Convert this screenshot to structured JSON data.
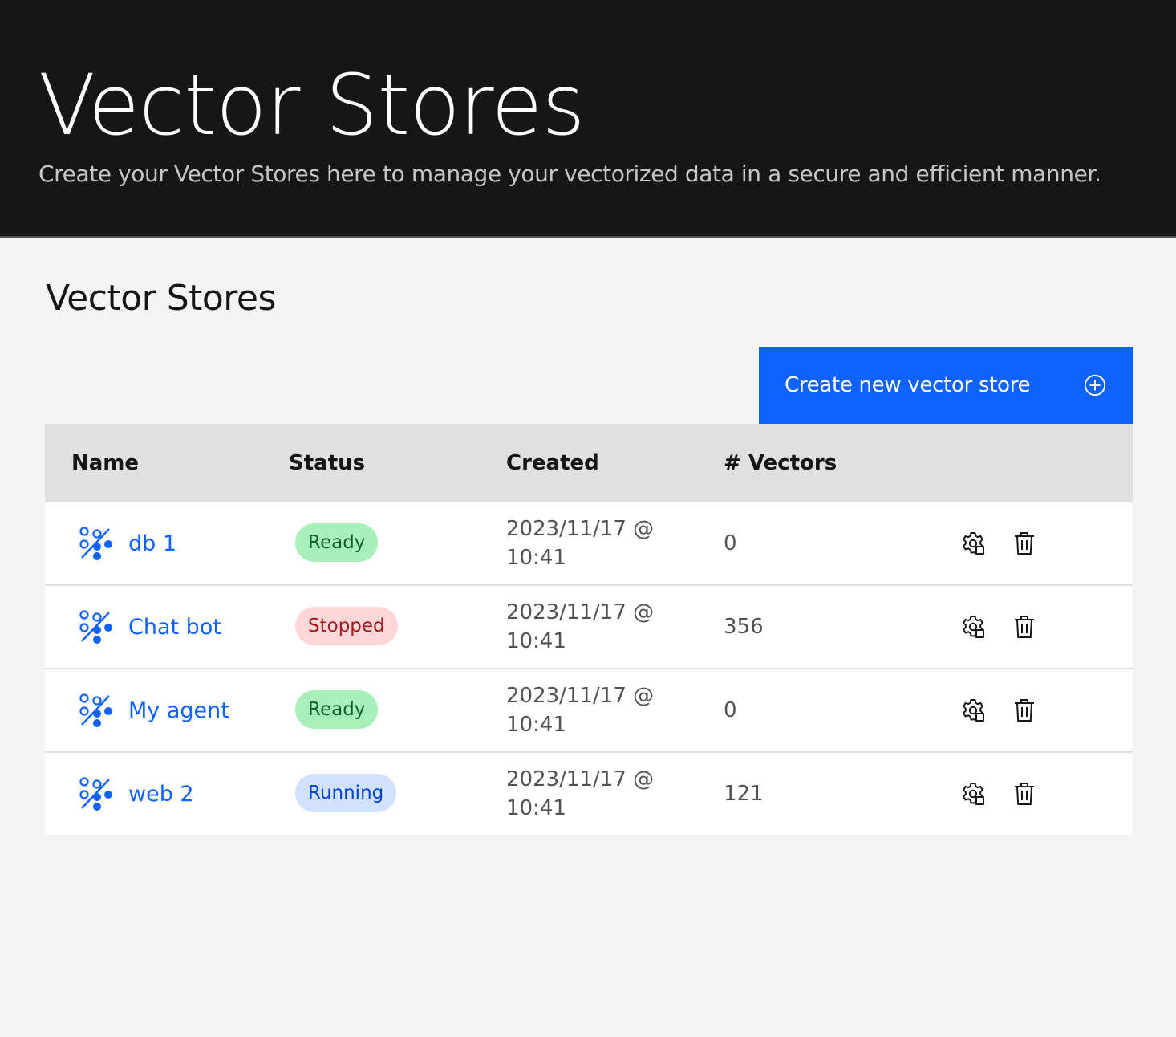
{
  "hero": {
    "title": "Vector Stores",
    "subtitle": "Create your Vector Stores here to manage your vectorized data in a secure and efficient manner."
  },
  "section": {
    "title": "Vector Stores"
  },
  "toolbar": {
    "create_label": "Create new vector store",
    "create_icon": "add-circle-icon"
  },
  "table": {
    "headers": [
      "Name",
      "Status",
      "Created",
      "# Vectors",
      ""
    ],
    "rows": [
      {
        "name": "db 1",
        "status": "Ready",
        "status_kind": "ready",
        "created": "2023/11/17 @ 10:41",
        "vectors": "0"
      },
      {
        "name": "Chat bot",
        "status": "Stopped",
        "status_kind": "stopped",
        "created": "2023/11/17 @ 10:41",
        "vectors": "356"
      },
      {
        "name": "My agent",
        "status": "Ready",
        "status_kind": "ready",
        "created": "2023/11/17 @ 10:41",
        "vectors": "0"
      },
      {
        "name": "web 2",
        "status": "Running",
        "status_kind": "running",
        "created": "2023/11/17 @ 10:41",
        "vectors": "121"
      }
    ]
  },
  "icons": {
    "row_icon": "percentage-vector-icon",
    "settings": "settings-gear-icon",
    "delete": "trash-can-icon"
  },
  "colors": {
    "hero_bg": "#161616",
    "primary": "#0f62fe",
    "ready_bg": "#a7f0ba",
    "stopped_bg": "#ffd7d9",
    "running_bg": "#d0e2ff"
  }
}
